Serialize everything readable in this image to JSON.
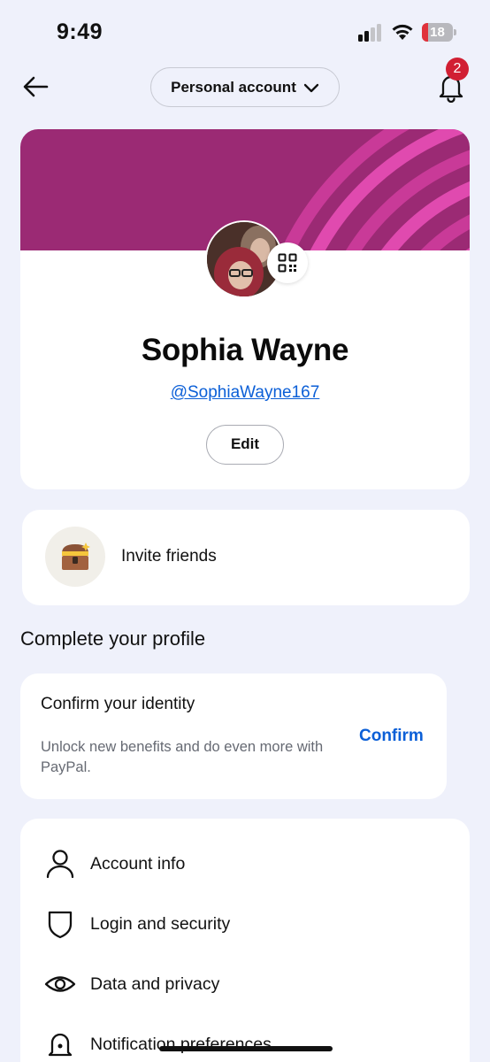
{
  "status_bar": {
    "time": "9:49",
    "battery_level": "18"
  },
  "nav": {
    "account_switch_label": "Personal account",
    "notification_count": "2"
  },
  "profile": {
    "name": "Sophia Wayne",
    "handle": "@SophiaWayne167",
    "edit_label": "Edit"
  },
  "invite": {
    "label": "Invite friends",
    "icon": "treasure-chest-icon"
  },
  "complete_profile": {
    "heading": "Complete your profile",
    "title": "Confirm your identity",
    "description": "Unlock new benefits and do even more with PayPal.",
    "action": "Confirm"
  },
  "menu": {
    "items": [
      {
        "label": "Account info",
        "icon": "person-icon"
      },
      {
        "label": "Login and security",
        "icon": "shield-icon"
      },
      {
        "label": "Data and privacy",
        "icon": "eye-icon"
      },
      {
        "label": "Notification preferences",
        "icon": "bell-gear-icon"
      }
    ]
  },
  "colors": {
    "background": "#eff1fb",
    "banner": "#9b2a74",
    "banner_stripes": "#e04aaf",
    "link": "#0b5fd7",
    "badge": "#d11f33"
  }
}
